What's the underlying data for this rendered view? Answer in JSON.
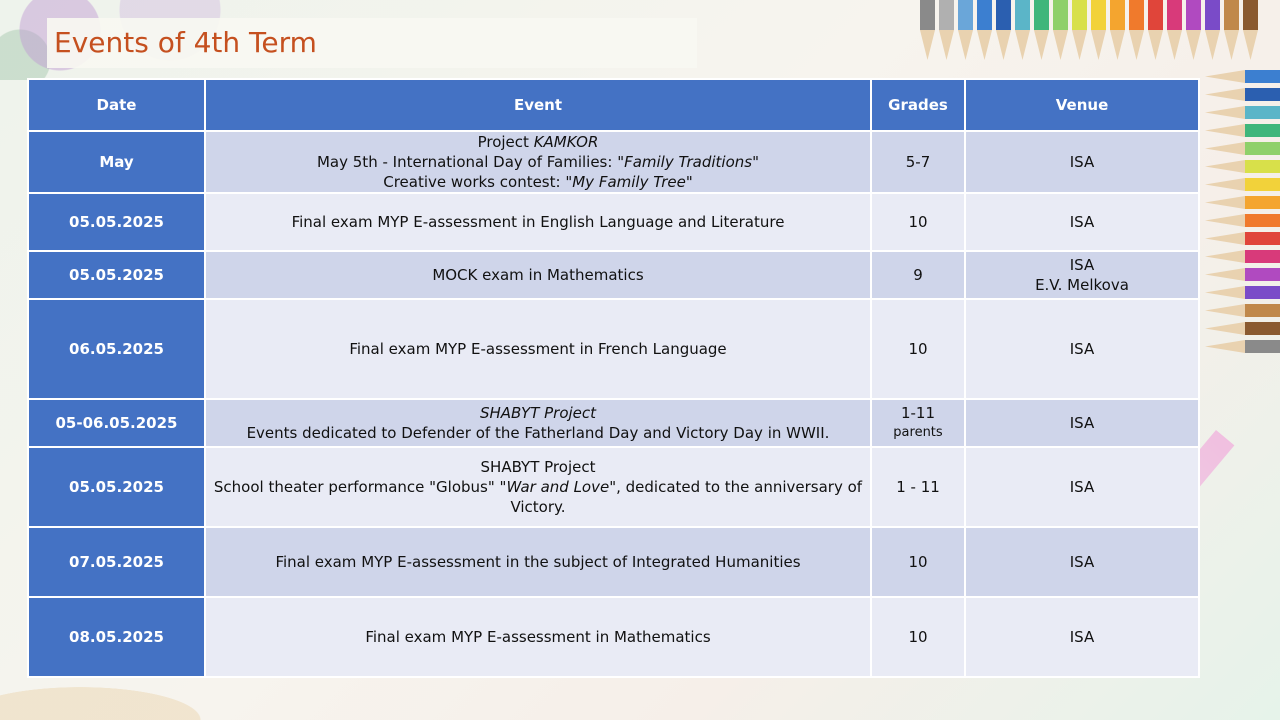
{
  "title": "Events of 4th Term",
  "table": {
    "headers": [
      "Date",
      "Event",
      "Grades",
      "Venue"
    ],
    "rows": [
      {
        "date": "May",
        "event": [
          {
            "pre": "Project ",
            "em": "KAMKOR",
            "post": ""
          },
          {
            "pre": "May 5th - International Day of Families: ",
            "em": "\"Family Traditions\"",
            "post": ""
          },
          {
            "pre": "Creative works contest: ",
            "em": "\"My Family Tree\"",
            "post": ""
          }
        ],
        "grades": "5-7",
        "grades_sub": "",
        "venue": "ISA",
        "venue_sub": ""
      },
      {
        "date": "05.05.2025",
        "event": [
          {
            "pre": "Final exam MYP E-assessment in English Language and Literature",
            "em": "",
            "post": ""
          }
        ],
        "grades": "10",
        "grades_sub": "",
        "venue": "ISA",
        "venue_sub": ""
      },
      {
        "date": "05.05.2025",
        "event": [
          {
            "pre": "MOCK exam in Mathematics",
            "em": "",
            "post": ""
          }
        ],
        "grades": "9",
        "grades_sub": "",
        "venue": "ISA",
        "venue_sub": "E.V. Melkova"
      },
      {
        "date": "06.05.2025",
        "event": [
          {
            "pre": "Final exam MYP E-assessment in French Language",
            "em": "",
            "post": ""
          }
        ],
        "grades": "10",
        "grades_sub": "",
        "venue": "ISA",
        "venue_sub": ""
      },
      {
        "date": "05-06.05.2025",
        "event": [
          {
            "pre": "",
            "em": "SHABYT Project",
            "post": ""
          },
          {
            "pre": "Events dedicated to Defender of the Fatherland Day and Victory Day in WWII.",
            "em": "",
            "post": ""
          }
        ],
        "grades": "1-11",
        "grades_sub": "parents",
        "venue": "ISA",
        "venue_sub": ""
      },
      {
        "date": "05.05.2025",
        "event": [
          {
            "pre": "SHABYT Project",
            "em": "",
            "post": ""
          },
          {
            "pre": "School theater performance \"Globus\" ",
            "em": "\"War and Love\"",
            "post": ", dedicated to the anniversary of Victory."
          }
        ],
        "grades": "1 - 11",
        "grades_sub": "",
        "venue": "ISA",
        "venue_sub": ""
      },
      {
        "date": "07.05.2025",
        "event": [
          {
            "pre": "Final exam MYP E-assessment in the subject of Integrated Humanities",
            "em": "",
            "post": ""
          }
        ],
        "grades": "10",
        "grades_sub": "",
        "venue": "ISA",
        "venue_sub": ""
      },
      {
        "date": "08.05.2025",
        "event": [
          {
            "pre": "Final exam MYP E-assessment in Mathematics",
            "em": "",
            "post": ""
          }
        ],
        "grades": "10",
        "grades_sub": "",
        "venue": "ISA",
        "venue_sub": ""
      }
    ]
  }
}
